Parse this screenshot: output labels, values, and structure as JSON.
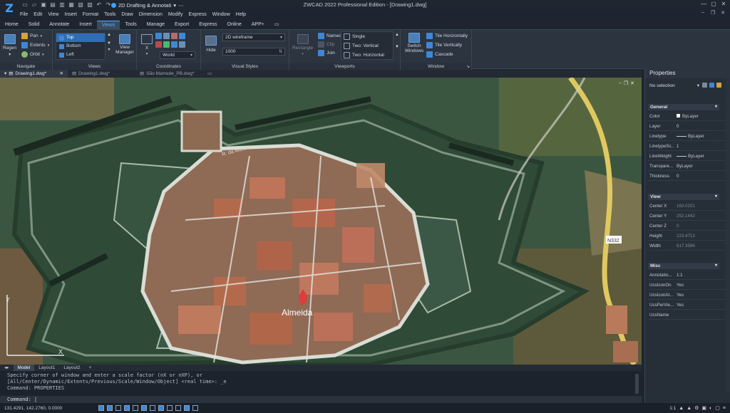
{
  "titlebar": {
    "workspace": "2D Drafting & Annotati",
    "title": "ZWCAD 2022 Professional Edition - [Drawing1.dwg]"
  },
  "menu": [
    "File",
    "Edit",
    "View",
    "Insert",
    "Format",
    "Tools",
    "Draw",
    "Dimension",
    "Modify",
    "Express",
    "Window",
    "Help"
  ],
  "tabs": [
    "Home",
    "Solid",
    "Annotate",
    "Insert",
    "Views",
    "Tools",
    "Manage",
    "Export",
    "Express",
    "Online",
    "APP+"
  ],
  "active_tab": "Views",
  "ribbon": {
    "navigate": {
      "title": "Navigate",
      "regen": "Regen",
      "pan": "Pan",
      "extents": "Extents",
      "orbit": "Orbit"
    },
    "views": {
      "title": "Views",
      "items": [
        "Top",
        "Bottom",
        "Left"
      ],
      "selected": "Top",
      "manager": "View Manager"
    },
    "coordinates": {
      "title": "Coordinates",
      "x": "X",
      "world": "World"
    },
    "visual_styles": {
      "title": "Visual Styles",
      "hide": "Hide",
      "style": "2D wireframe",
      "value": "1000"
    },
    "viewports": {
      "title": "Viewports",
      "rectangle": "Rectangle",
      "named": "Named",
      "clip": "Clip",
      "join": "Join",
      "single": "Single",
      "two_vertical": "Two: Vertical",
      "two_horizontal": "Two: Horizontal"
    },
    "window": {
      "title": "Window",
      "switch": "Switch Windows",
      "tile_h": "Tile Horizontally",
      "tile_v": "Tile Vertically",
      "cascade": "Cascade"
    }
  },
  "doc_tabs": [
    "Drawing1.dwg*",
    "Drawing1.dwg*",
    "São Mamede_PB.dwg*"
  ],
  "map": {
    "town_label": "Almeida",
    "road_label": "N332",
    "street1": "R. da Muralha"
  },
  "layout_tabs": [
    "Model",
    "Layout1",
    "Layout2",
    "+"
  ],
  "command": {
    "lines": [
      "Specify corner of window and enter a scale factor (nX or nXP), or",
      "[All/Center/Dynamic/Extents/Previous/Scale/Window/Object] <real time>: _e",
      "Command: PROPERTIES"
    ],
    "prompt": "Command:"
  },
  "status": {
    "coords": "131.4291, 142.2760, 0.0000",
    "scale": "1:1"
  },
  "properties": {
    "title": "Properties",
    "selection": "No selection",
    "general": {
      "title": "General",
      "rows": [
        [
          "Color",
          "ByLayer"
        ],
        [
          "Layer",
          "0"
        ],
        [
          "Linetype",
          "ByLayer"
        ],
        [
          "LinetypeSc...",
          "1"
        ],
        [
          "LineWeight",
          "ByLayer"
        ],
        [
          "Transpare...",
          "ByLayer"
        ],
        [
          "Thickness",
          "0"
        ]
      ]
    },
    "view": {
      "title": "View",
      "rows": [
        [
          "Center X",
          "163.0201"
        ],
        [
          "Center Y",
          "252.1442"
        ],
        [
          "Center Z",
          "0"
        ],
        [
          "Height",
          "223.4713"
        ],
        [
          "Width",
          "617.3596"
        ]
      ]
    },
    "misc": {
      "title": "Misc",
      "rows": [
        [
          "Annotatio...",
          "1:1"
        ],
        [
          "UcsIconOn",
          "Yes"
        ],
        [
          "UcsIconAt...",
          "Yes"
        ],
        [
          "UcsPerVie...",
          "Yes"
        ],
        [
          "UcsName",
          ""
        ]
      ]
    }
  },
  "colors": {
    "accent": "#4fb0ff",
    "ribbon": "#2c3440",
    "panel": "#262e38"
  }
}
